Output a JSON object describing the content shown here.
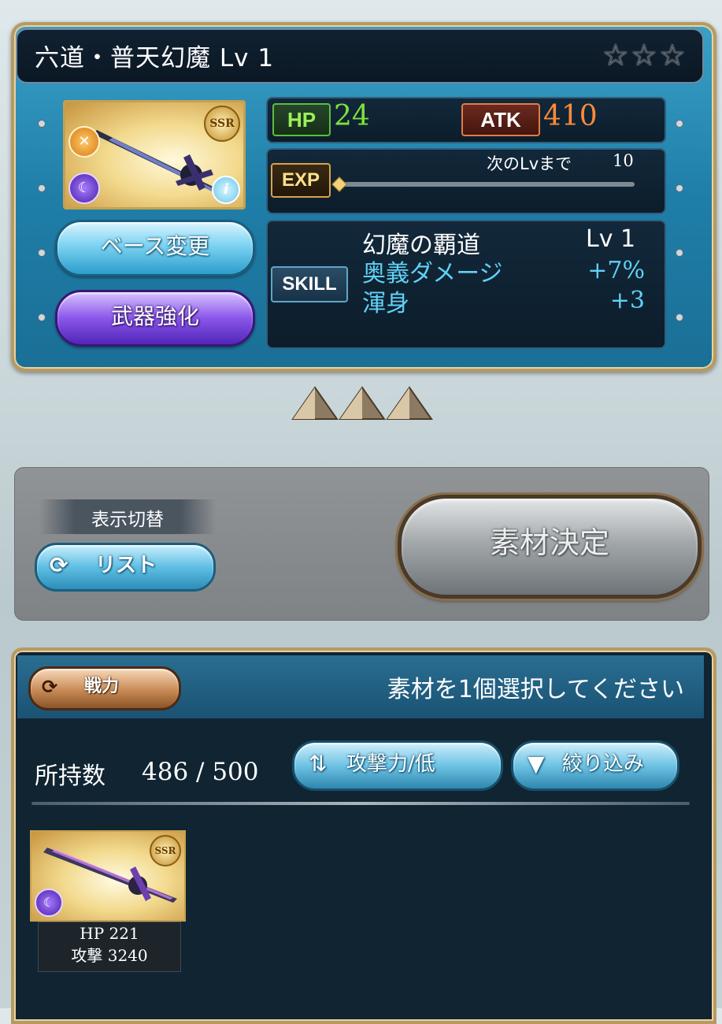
{
  "weapon": {
    "title": "六道・普天幻魔 Lv 1",
    "rarity_stars": "☆☆☆",
    "rarity_badge": "SSR",
    "element_icon": "dark-element-icon",
    "hp_label": "HP",
    "hp_value": "24",
    "atk_label": "ATK",
    "atk_value": "410",
    "exp_label": "EXP",
    "exp_next_label": "次のLvまで",
    "exp_next_value": "10",
    "exp_progress": 0.0,
    "skill_label": "SKILL",
    "skill_name": "幻魔の覇道",
    "skill_level": "Lv 1",
    "skill_effects": [
      {
        "name": "奥義ダメージ",
        "value": "+7%"
      },
      {
        "name": "渾身",
        "value": "+3"
      }
    ]
  },
  "buttons": {
    "change_base": "ベース変更",
    "enhance_weapon": "武器強化",
    "display_toggle_label": "表示切替",
    "list_view": "リスト",
    "confirm_material": "素材決定",
    "sort_power": "戦力",
    "sort_order": "攻撃力/低",
    "filter": "絞り込み"
  },
  "materials": {
    "instruction": "素材を1個選択してください",
    "owned_label": "所持数",
    "owned_count": "486 / 500",
    "items": [
      {
        "rarity": "SSR",
        "hp": "HP  221",
        "atk": "攻撃 3240"
      }
    ]
  },
  "colors": {
    "hp": "#7de23a",
    "atk": "#ff8a3a",
    "skill_effect": "#5fd2f6",
    "panel_blue": "#1f7ea8",
    "gold_frame": "#b79a63"
  }
}
